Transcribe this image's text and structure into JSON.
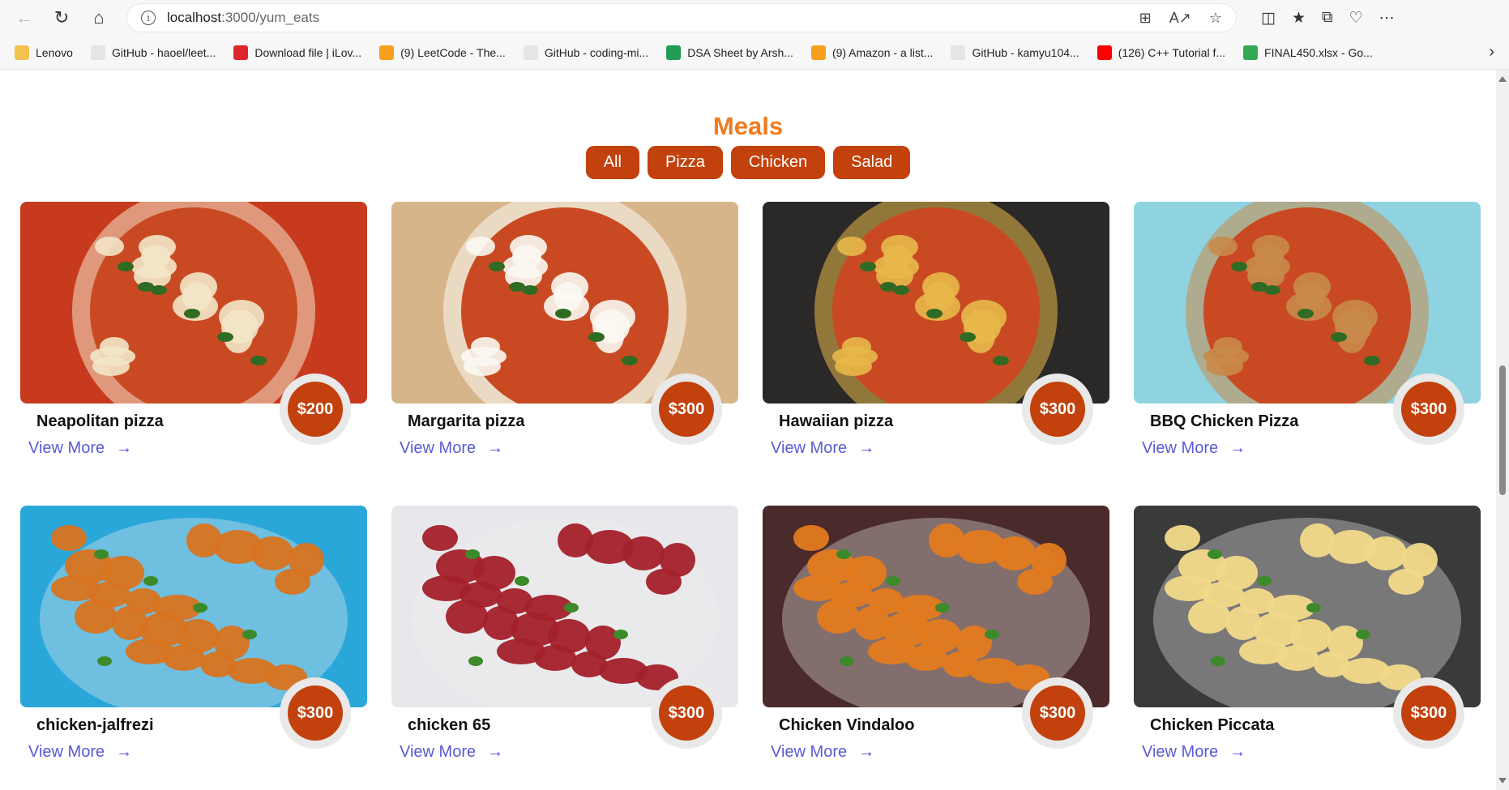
{
  "browser": {
    "url_host": "localhost",
    "url_path": ":3000/yum_eats",
    "bookmarks": [
      {
        "label": "Lenovo",
        "color": "#f2c14e"
      },
      {
        "label": "GitHub - haoel/leet...",
        "color": "#e5e5e5"
      },
      {
        "label": "Download file | iLov...",
        "color": "#e0242b"
      },
      {
        "label": "(9) LeetCode - The...",
        "color": "#f89f1b"
      },
      {
        "label": "GitHub - coding-mi...",
        "color": "#e5e5e5"
      },
      {
        "label": "DSA Sheet by Arsh...",
        "color": "#1f9d55"
      },
      {
        "label": "(9) Amazon - a list...",
        "color": "#f89f1b"
      },
      {
        "label": "GitHub - kamyu104...",
        "color": "#e5e5e5"
      },
      {
        "label": "(126) C++ Tutorial f...",
        "color": "#ff0000"
      },
      {
        "label": "FINAL450.xlsx - Go...",
        "color": "#34a853"
      }
    ]
  },
  "page": {
    "title": "Meals",
    "filters": [
      "All",
      "Pizza",
      "Chicken",
      "Salad"
    ],
    "view_more_label": "View More",
    "items": [
      {
        "name": "Neapolitan pizza",
        "price": "$200",
        "bg": "#c83a1e",
        "accent": "#f3e6c8"
      },
      {
        "name": "Margarita pizza",
        "price": "$300",
        "bg": "#d7b58a",
        "accent": "#fbf8f2"
      },
      {
        "name": "Hawaiian pizza",
        "price": "$300",
        "bg": "#2b2828",
        "accent": "#e8b84a"
      },
      {
        "name": "BBQ Chicken Pizza",
        "price": "$300",
        "bg": "#8fd2e0",
        "accent": "#c98a4a"
      },
      {
        "name": "chicken-jalfrezi",
        "price": "$300",
        "bg": "#2aa7d9",
        "accent": "#d8731f"
      },
      {
        "name": "chicken 65",
        "price": "$300",
        "bg": "#e8e8ec",
        "accent": "#a3202a"
      },
      {
        "name": "Chicken Vindaloo",
        "price": "$300",
        "bg": "#4a2a2a",
        "accent": "#e27a1e"
      },
      {
        "name": "Chicken Piccata",
        "price": "$300",
        "bg": "#3a3a3a",
        "accent": "#f2d98a"
      }
    ]
  }
}
